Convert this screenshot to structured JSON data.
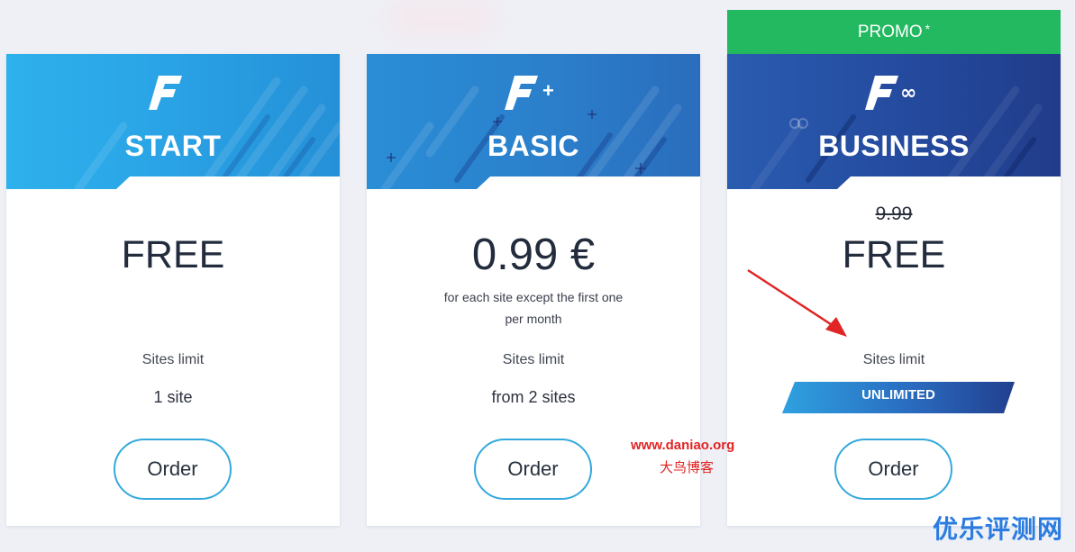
{
  "plans": [
    {
      "id": "start",
      "logo_suffix": "",
      "name": "START",
      "price": "FREE",
      "sites_label": "Sites limit",
      "sites_value": "1 site",
      "order_label": "Order"
    },
    {
      "id": "basic",
      "logo_suffix": "+",
      "name": "BASIC",
      "price": "0.99 €",
      "price_note_1": "for each site except the first one",
      "price_note_2": "per month",
      "sites_label": "Sites limit",
      "sites_value": "from 2 sites",
      "order_label": "Order"
    },
    {
      "id": "business",
      "logo_suffix": "∞",
      "name": "BUSINESS",
      "promo_label": "PROMO",
      "promo_mark": "*",
      "old_price": "9.99",
      "price": "FREE",
      "sites_label": "Sites limit",
      "sites_value": "UNLIMITED",
      "order_label": "Order"
    }
  ],
  "watermarks": {
    "site_url": "www.daniao.org",
    "site_name": "大鸟博客",
    "corner": "优乐评测网"
  },
  "colors": {
    "start_header": "#2aa4e6",
    "basic_header": "#2b7fcb",
    "business_header": "#244a9e",
    "promo_bar": "#22b960",
    "button_border": "#33a9dc",
    "annotation_arrow": "#e12424"
  },
  "icons": {
    "logo": "brand-f-logo-icon",
    "annotation": "red-arrow-icon"
  }
}
